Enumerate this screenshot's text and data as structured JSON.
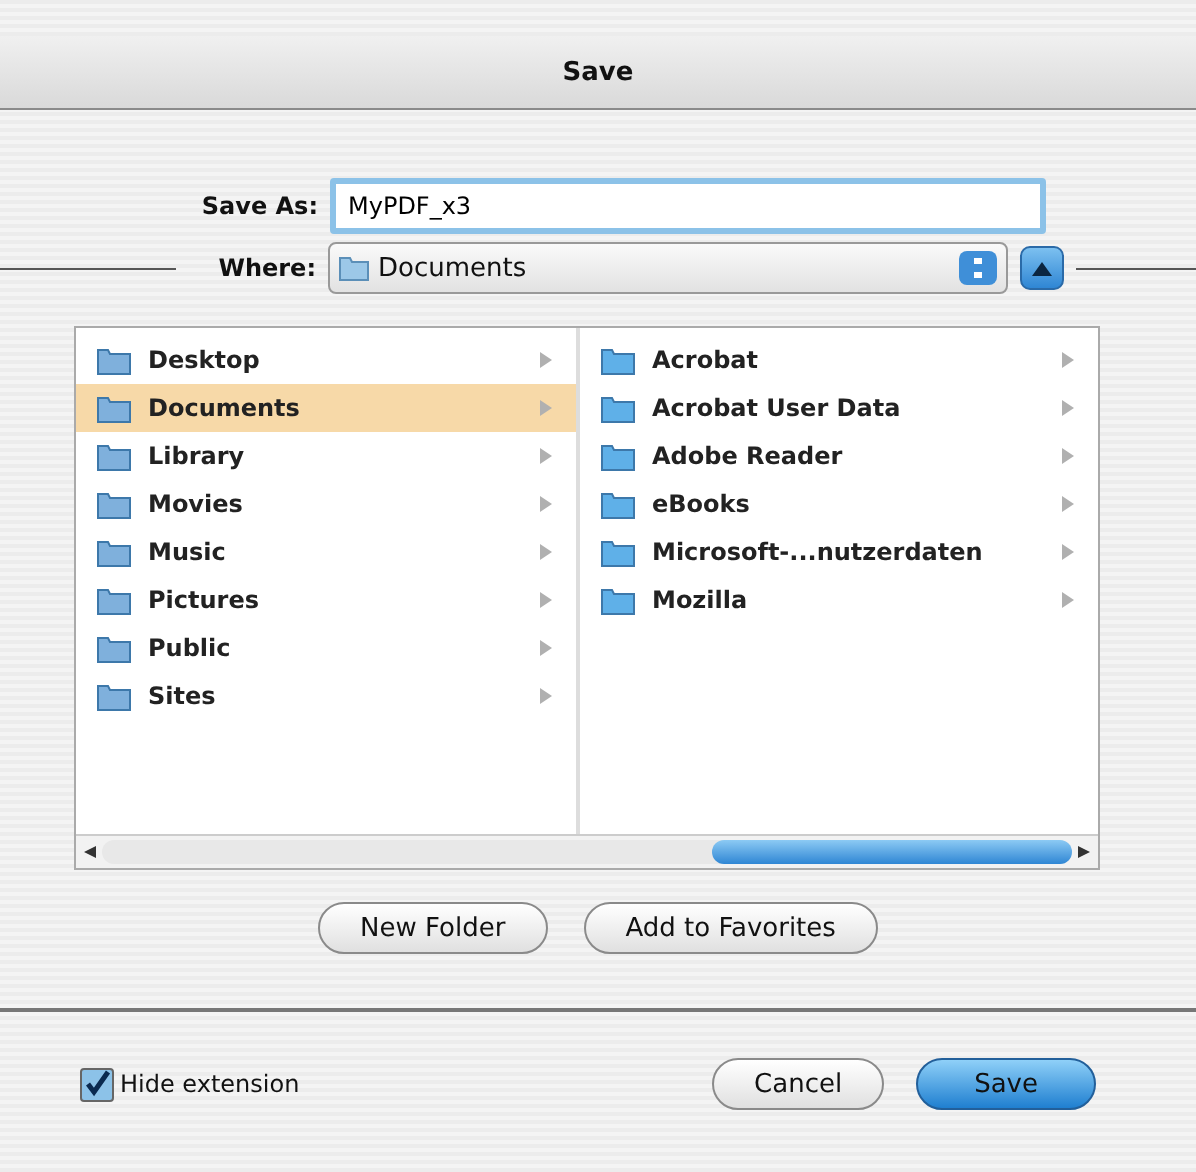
{
  "window": {
    "title": "Save"
  },
  "save_as": {
    "label": "Save As:",
    "value": "MyPDF_x3"
  },
  "where": {
    "label": "Where:",
    "value": "Documents",
    "expanded": true
  },
  "columns": [
    {
      "items": [
        {
          "label": "Desktop",
          "selected": false
        },
        {
          "label": "Documents",
          "selected": true
        },
        {
          "label": "Library",
          "selected": false
        },
        {
          "label": "Movies",
          "selected": false
        },
        {
          "label": "Music",
          "selected": false
        },
        {
          "label": "Pictures",
          "selected": false
        },
        {
          "label": "Public",
          "selected": false
        },
        {
          "label": "Sites",
          "selected": false
        }
      ]
    },
    {
      "items": [
        {
          "label": "Acrobat",
          "selected": false
        },
        {
          "label": "Acrobat User Data",
          "selected": false
        },
        {
          "label": "Adobe Reader",
          "selected": false
        },
        {
          "label": "eBooks",
          "selected": false
        },
        {
          "label": "Microsoft-...nutzerdaten",
          "selected": false
        },
        {
          "label": "Mozilla",
          "selected": false
        }
      ]
    }
  ],
  "browser_buttons": [
    "New Folder",
    "Add to Favorites"
  ],
  "hide_extension": {
    "label": "Hide extension",
    "checked": true
  },
  "buttons": [
    {
      "label": "Cancel",
      "default": false
    },
    {
      "label": "Save",
      "default": true
    }
  ]
}
